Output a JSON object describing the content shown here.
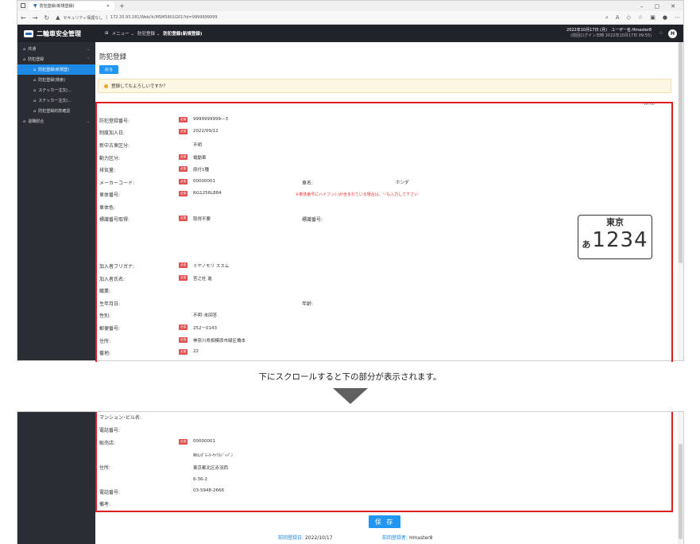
{
  "browser": {
    "tab_title": "防犯登録(新規登録)",
    "new_tab": "+",
    "security_warning": "セキュリティ保護なし",
    "url": "172.20.93.181/Web/※/MSM5801G01?id=9999999999",
    "win_minimize": "–",
    "win_restore": "▢",
    "win_close": "✕"
  },
  "header": {
    "app_name": "二輪車安全管理",
    "menu": "メニュー",
    "crumb_1": "防犯登録",
    "crumb_current": "防犯登録(新規登録)",
    "user_line": "2022年10月17日 (月)　ユーザー名:Hmaster8",
    "last_login": "(前回ログイン日時 2022年10月17日 09:55)",
    "avatar": "H"
  },
  "sidebar": {
    "common": "共通",
    "crime": "防犯登録",
    "items": [
      "防犯登録(新規登)",
      "防犯登録(検索)",
      "ステッカー注文(...",
      "ステッカー注文(...",
      "防犯登録約款確認"
    ],
    "association": "退職慰合"
  },
  "page": {
    "title": "防犯登録",
    "back_button": "戻る",
    "confirm": "登録してもよろしいですか？",
    "version": "Ver.00"
  },
  "required_badge": "必須",
  "form": {
    "reg_no_label": "防犯登録番号:",
    "reg_no": "9999999999—3",
    "join_date_label": "制度加入日:",
    "join_date": "2022/09/12",
    "newold_label": "新中古車区分:",
    "newold": "不明",
    "power_label": "動力区分:",
    "power": "電動車",
    "disp_label": "排気量:",
    "disp": "原付1種",
    "maker_label": "メーカーコード:",
    "maker": "00000001",
    "carname_label": "車名:",
    "carname": "ホンダ",
    "chassis_label": "車体番号:",
    "chassis": "RG1256L884",
    "chassis_note": "※車体番号にハイフン(-)が含まれている場合は、'-'も入力して下さい",
    "color_label": "車体色:",
    "plate_label": "標識番号取得:",
    "plate": "取得不要",
    "plate_no_label": "標識番号:",
    "kana_label": "加入者フリガナ:",
    "kana": "ミヤノモリ ススム",
    "name_label": "加入者氏名:",
    "name": "宮之杜 進",
    "job_label": "職業:",
    "birth_label": "生年月日:",
    "age_label": "年齢:",
    "sex_label": "性別:",
    "sex": "不明･未回答",
    "zip_label": "郵便番号:",
    "zip": "252－0143",
    "addr_label": "住所:",
    "addr": "神奈川県相模原市緑区橋本",
    "banchi_label": "番地:",
    "banchi": "22"
  },
  "license_plate": {
    "prefecture": "東京",
    "kana": "あ",
    "number": "1234"
  },
  "caption": "下にスクロールすると下の部分が表示されます。",
  "form2": {
    "mansion_label": "マンション･ビル名:",
    "tel_label": "電話番号:",
    "dealer_label": "販売店:",
    "dealer": "00000001",
    "dealer_name": "㈱ﾎﾝﾀﾞﾓｰﾀｰｻｲｸﾙｼﾞｬﾊﾟﾝ",
    "dealer_addr_label": "住所:",
    "dealer_addr": "東京都北区赤羽西",
    "dealer_banchi": "6-36-2",
    "dealer_tel_label": "電話番号:",
    "dealer_tel": "03-5948-2666",
    "remarks_label": "備考:"
  },
  "save_button": "保 存",
  "footer": {
    "last_date_label": "前回登録日:",
    "last_date": "2022/10/17",
    "last_user_label": "前回登録者:",
    "last_user": "Hmaster8"
  },
  "colors": {
    "primary": "#2196f3",
    "danger": "#e02020",
    "header": "#20232a"
  }
}
